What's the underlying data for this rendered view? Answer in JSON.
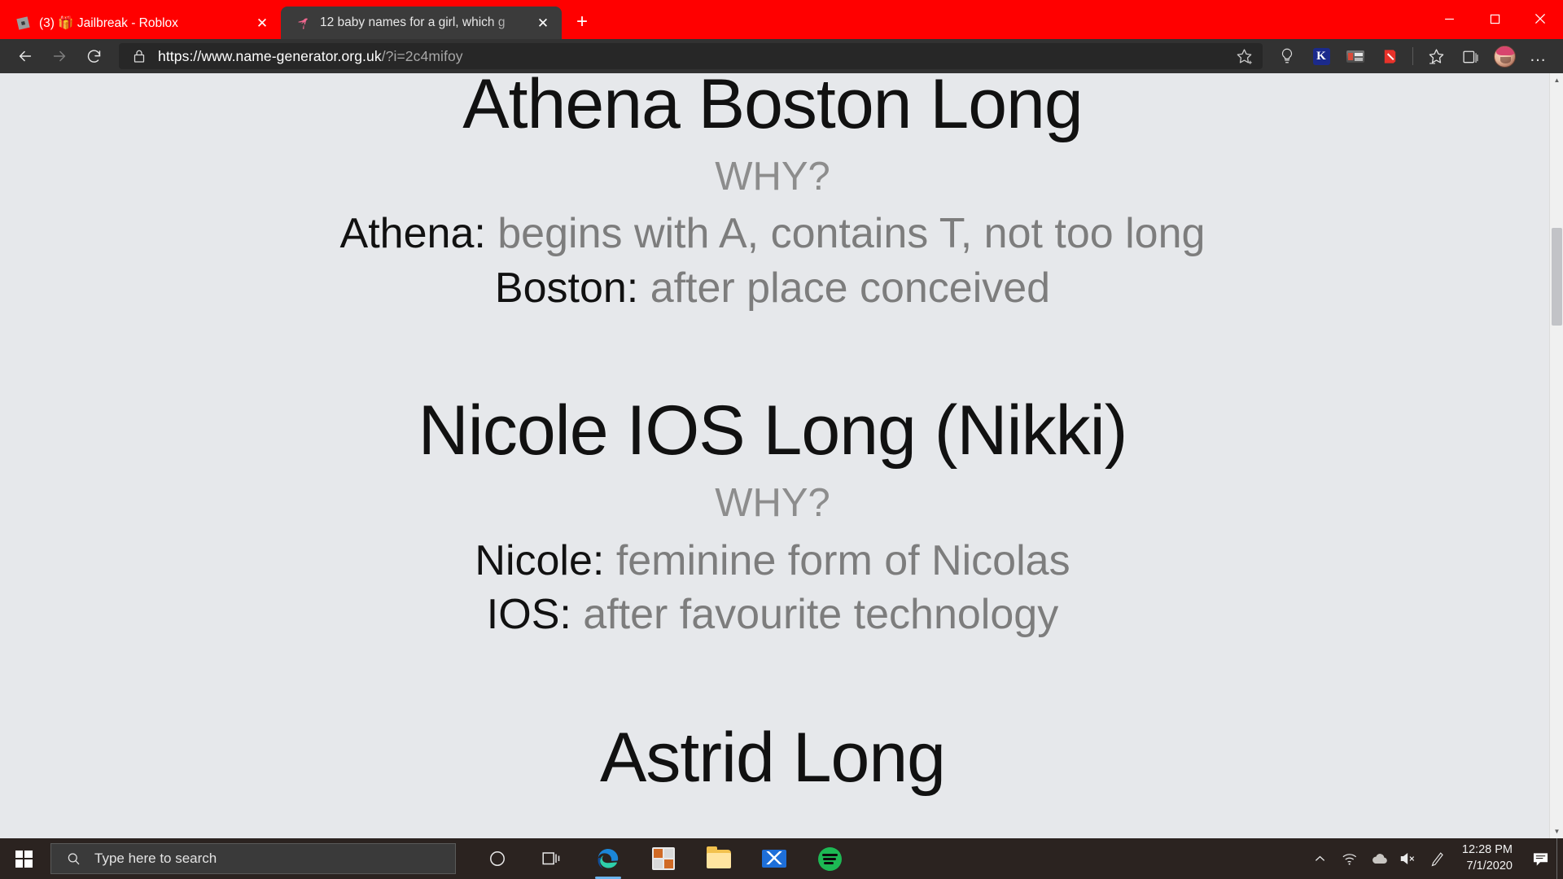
{
  "window": {
    "controls": [
      {
        "name": "minimize",
        "glyph": "─"
      },
      {
        "name": "maximize",
        "glyph": "□"
      },
      {
        "name": "close",
        "glyph": "✕"
      }
    ]
  },
  "tabs": [
    {
      "title": "(3) 🎁 Jailbreak - Roblox",
      "favicon": "roblox-icon",
      "active": false,
      "close_label": "✕"
    },
    {
      "title": "12 baby names for a girl, which g",
      "favicon": "flamingo-icon",
      "active": true,
      "close_label": "✕"
    }
  ],
  "newtab_label": "+",
  "toolbar": {
    "back_label": "←",
    "forward_label": "→",
    "refresh_label": "↻",
    "url_scheme": "https://www.",
    "url_domain": "name-generator.org.uk",
    "url_path": "/?i=2c4mifoy",
    "url_full": "https://www.name-generator.org.uk/?i=2c4mifoy",
    "bookmark_label": "☆",
    "extensions": [
      {
        "name": "lightbulb-extension-icon"
      },
      {
        "name": "kami-extension-icon",
        "label": "K"
      },
      {
        "name": "screen-capture-extension-icon"
      },
      {
        "name": "adblock-extension-icon"
      }
    ],
    "favorites_label": "☆",
    "collections_label": "⊞",
    "profile_label": "profile-avatar",
    "settings_label": "…"
  },
  "page": {
    "accent_gray": "#7d7d7d",
    "background": "#e6e8eb",
    "entries": [
      {
        "name": "Athena Boston Long",
        "why_label": "WHY?",
        "reasons": [
          {
            "part": "Athena",
            "explanation": "begins with A, contains T, not too long"
          },
          {
            "part": "Boston",
            "explanation": "after place conceived"
          }
        ]
      },
      {
        "name": "Nicole IOS Long (Nikki)",
        "why_label": "WHY?",
        "reasons": [
          {
            "part": "Nicole",
            "explanation": "feminine form of Nicolas"
          },
          {
            "part": "IOS",
            "explanation": "after favourite technology"
          }
        ]
      },
      {
        "name": "Astrid Long",
        "why_label": "",
        "reasons": []
      }
    ]
  },
  "scrollbar": {
    "up_label": "▲",
    "down_label": "▼"
  },
  "taskbar": {
    "start_label": "start-button",
    "search_placeholder": "Type here to search",
    "cortana_label": "○",
    "taskview_label": "task-view",
    "apps": [
      {
        "name": "microsoft-edge",
        "running": true
      },
      {
        "name": "microsoft-store",
        "running": false
      },
      {
        "name": "file-explorer",
        "running": false
      },
      {
        "name": "mail",
        "running": false
      },
      {
        "name": "spotify",
        "running": false
      }
    ],
    "tray": [
      {
        "name": "show-hidden-icons-chevron",
        "glyph": "∧"
      },
      {
        "name": "wifi-icon"
      },
      {
        "name": "onedrive-cloud-icon"
      },
      {
        "name": "volume-muted-icon"
      },
      {
        "name": "pen-icon"
      }
    ],
    "time": "12:28 PM",
    "date": "7/1/2020",
    "notification_label": "notifications"
  }
}
